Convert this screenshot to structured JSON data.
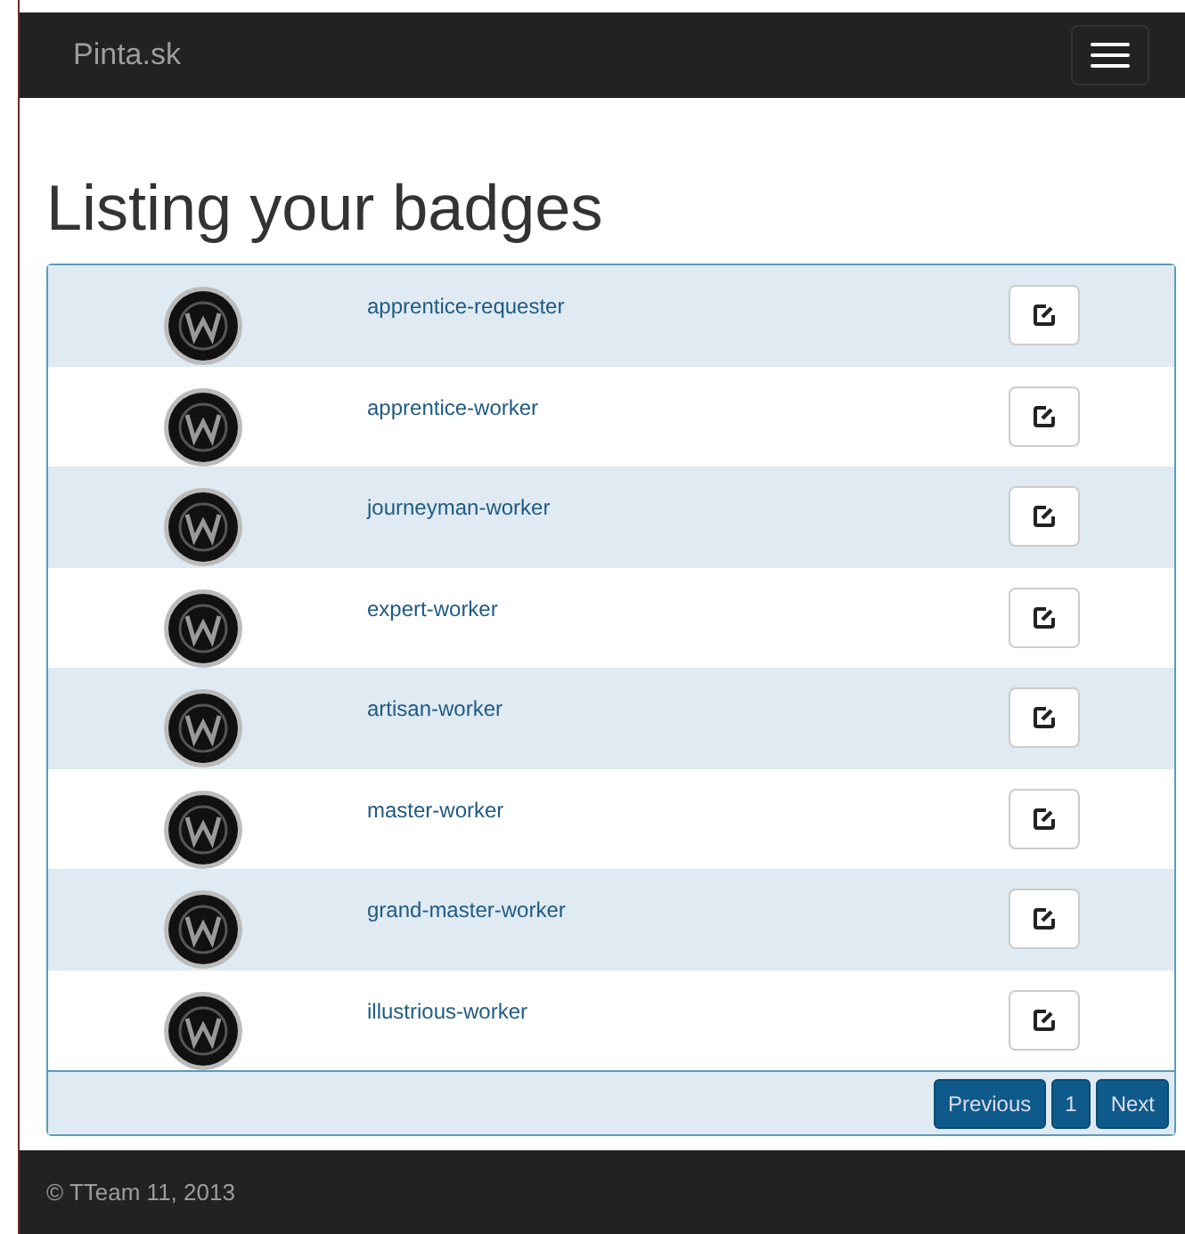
{
  "navbar": {
    "brand": "Pinta.sk"
  },
  "heading": "Listing your badges",
  "badges": [
    {
      "name": "apprentice-requester"
    },
    {
      "name": "apprentice-worker"
    },
    {
      "name": "journeyman-worker"
    },
    {
      "name": "expert-worker"
    },
    {
      "name": "artisan-worker"
    },
    {
      "name": "master-worker"
    },
    {
      "name": "grand-master-worker"
    },
    {
      "name": "illustrious-worker"
    }
  ],
  "pagination": [
    "Previous",
    "1",
    "Next"
  ],
  "footer": "© TTeam 11, 2013"
}
